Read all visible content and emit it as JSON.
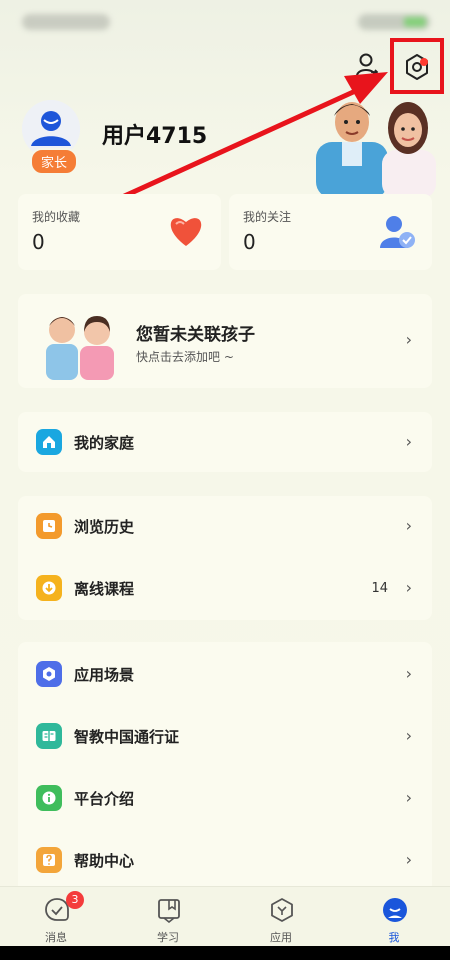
{
  "profile": {
    "username": "用户4715",
    "role": "家长"
  },
  "stats": {
    "favorites_label": "我的收藏",
    "favorites_count": "0",
    "following_label": "我的关注",
    "following_count": "0"
  },
  "child": {
    "title": "您暂未关联孩子",
    "subtitle": "快点击去添加吧 ~"
  },
  "menu": {
    "family": {
      "label": "我的家庭",
      "icon": "home-icon"
    },
    "history": {
      "label": "浏览历史",
      "icon": "clock-icon"
    },
    "offline": {
      "label": "离线课程",
      "icon": "download-icon",
      "count": "14"
    },
    "scenes": {
      "label": "应用场景",
      "icon": "cube-icon"
    },
    "passport": {
      "label": "智教中国通行证",
      "icon": "passport-icon"
    },
    "intro": {
      "label": "平台介绍",
      "icon": "info-icon"
    },
    "help": {
      "label": "帮助中心",
      "icon": "help-icon"
    }
  },
  "tabbar": {
    "messages": {
      "label": "消息",
      "badge": "3"
    },
    "learn": {
      "label": "学习"
    },
    "apps": {
      "label": "应用"
    },
    "me": {
      "label": "我"
    }
  },
  "colors": {
    "accent": "#1a56db",
    "highlight": "#e8141c",
    "role_badge": "#f57d36"
  }
}
